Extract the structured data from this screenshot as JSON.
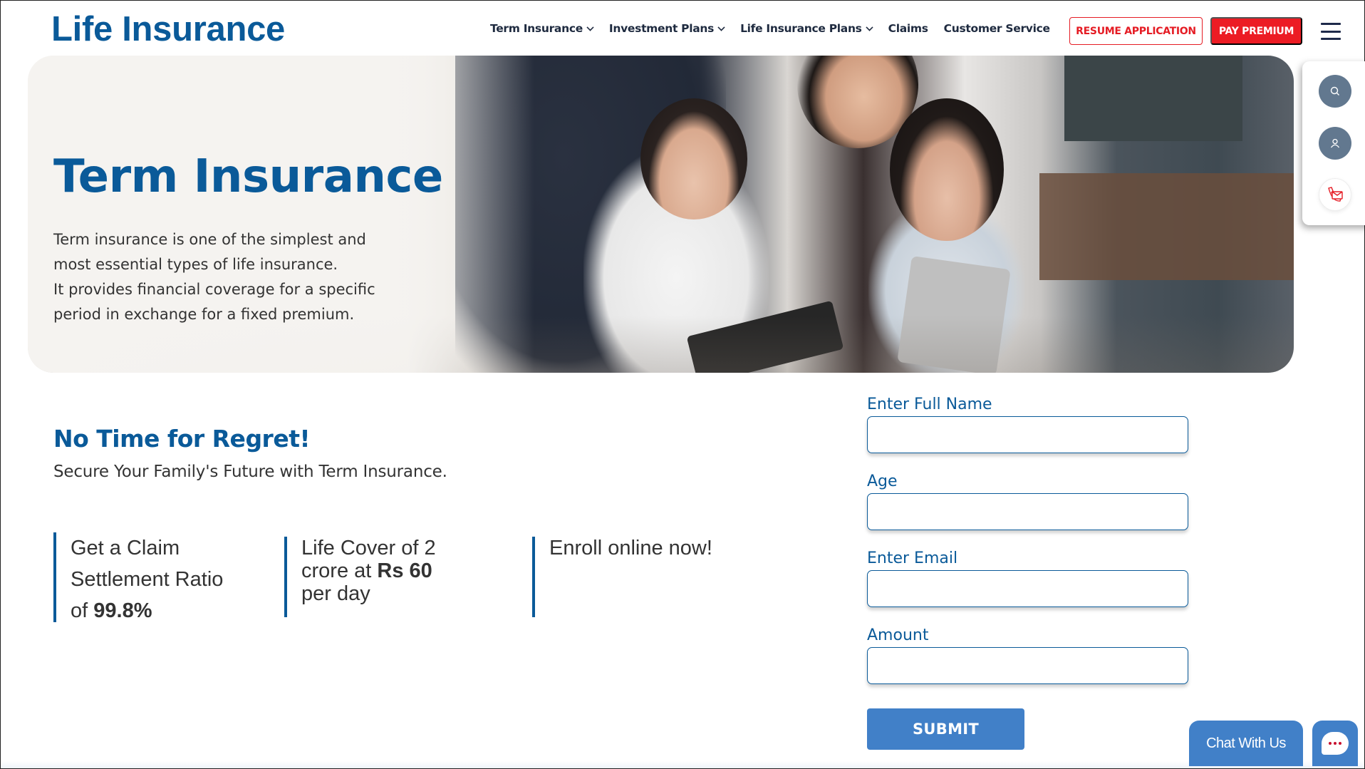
{
  "header": {
    "logo": "Life Insurance",
    "nav": [
      {
        "label": "Term Insurance",
        "has_dropdown": true
      },
      {
        "label": "Investment Plans",
        "has_dropdown": true
      },
      {
        "label": "Life Insurance Plans",
        "has_dropdown": true
      },
      {
        "label": "Claims",
        "has_dropdown": false
      },
      {
        "label": "Customer Service",
        "has_dropdown": false
      }
    ],
    "resume_button": "RESUME APPLICATION",
    "pay_button": "PAY PREMIUM",
    "menu_icon": "hamburger-icon"
  },
  "colors": {
    "brand_blue": "#0a5a99",
    "accent_red": "#ec1c24",
    "button_blue": "#4180c8",
    "side_icon_gray": "#62788f"
  },
  "hero": {
    "title": "Term Insurance",
    "description_lines": [
      "Term insurance is one of the simplest and",
      "most essential types of life insurance.",
      "It provides financial coverage for a specific",
      "period in exchange for a fixed premium."
    ],
    "image_alt": "Family with two children using tablets"
  },
  "side_panel": {
    "icons": [
      "search-icon",
      "user-icon",
      "phone-mail-icon"
    ]
  },
  "section": {
    "title": "No Time for Regret!",
    "subtitle": "Secure Your Family's Future with Term Insurance."
  },
  "features": [
    {
      "line1": "Get a Claim",
      "line2": "Settlement Ratio",
      "prefix": "of ",
      "bold": "99.8%"
    },
    {
      "line1": "Life Cover of 2",
      "line2_prefix": "crore at ",
      "bold": "Rs 60",
      "line3": "per day"
    },
    {
      "line1": "Enroll online now!"
    }
  ],
  "form": {
    "fields": [
      {
        "label": "Enter Full Name",
        "value": "",
        "placeholder": ""
      },
      {
        "label": "Age",
        "value": "",
        "placeholder": ""
      },
      {
        "label": "Enter Email",
        "value": "",
        "placeholder": ""
      },
      {
        "label": "Amount",
        "value": "",
        "placeholder": ""
      }
    ],
    "submit_label": "SUBMIT"
  },
  "chat": {
    "label": "Chat With Us",
    "icon": "chat-bubble-icon"
  }
}
